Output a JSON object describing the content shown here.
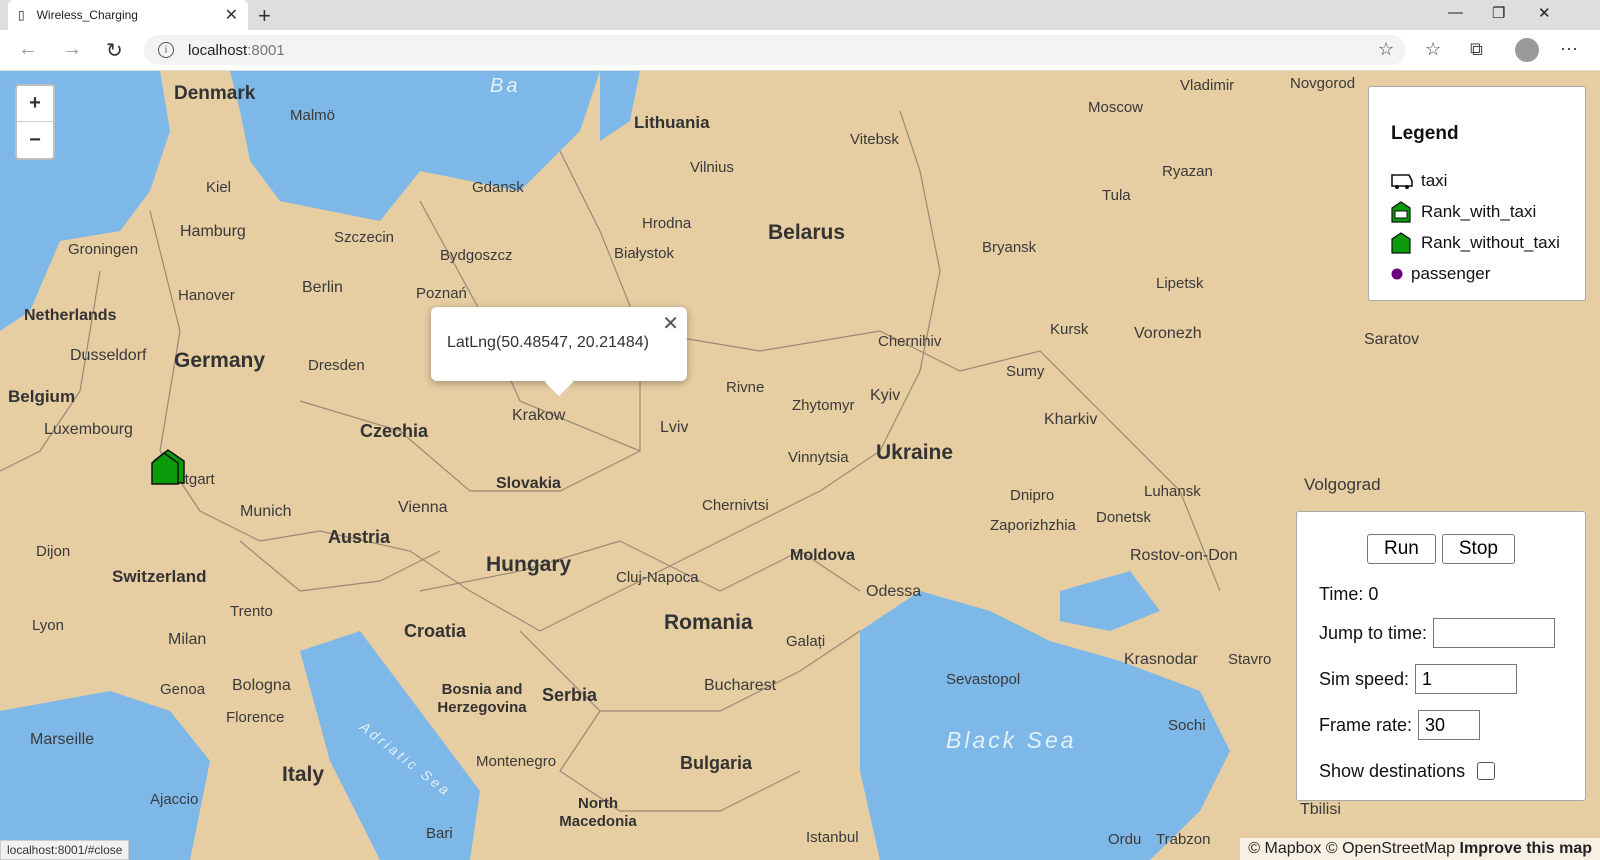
{
  "browser": {
    "tab_title": "Wireless_Charging",
    "address_host": "localhost",
    "address_port": ":8001",
    "status_url": "localhost:8001/#close"
  },
  "map": {
    "zoom_in": "+",
    "zoom_out": "−",
    "popup_text": "LatLng(50.48547, 20.21484)",
    "popup_close": "✕",
    "labels": {
      "denmark": "Denmark",
      "malmo": "Malmö",
      "lithuania": "Lithuania",
      "vilnius": "Vilnius",
      "moscow": "Moscow",
      "vladimir": "Vladimir",
      "novgorod": "Novgorod",
      "vitebsk": "Vitebsk",
      "kiel": "Kiel",
      "gdansk": "Gdansk",
      "hrodna": "Hrodna",
      "belarus": "Belarus",
      "ryazan": "Ryazan",
      "tula": "Tula",
      "groningen": "Groningen",
      "hamburg": "Hamburg",
      "szczecin": "Szczecin",
      "bydgoszcz": "Bydgoszcz",
      "bialystok": "Białystok",
      "bryansk": "Bryansk",
      "hanover": "Hanover",
      "berlin": "Berlin",
      "poznan": "Poznań",
      "lipetsk": "Lipetsk",
      "netherlands": "Netherlands",
      "dusseldorf": "Dusseldorf",
      "germany": "Germany",
      "dresden": "Dresden",
      "chernihiv": "Chernihiv",
      "kursk": "Kursk",
      "voronezh": "Voronezh",
      "saratov": "Saratov",
      "belgium": "Belgium",
      "krakow": "Krakow",
      "rivne": "Rivne",
      "zhytomyr": "Zhytomyr",
      "kyiv": "Kyiv",
      "sumy": "Sumy",
      "luxembourg": "Luxembourg",
      "czechia": "Czechia",
      "lviv": "Lviv",
      "kharkiv": "Kharkiv",
      "ukraine": "Ukraine",
      "vinnytsia": "Vinnytsia",
      "stuttgart": "Stuttgart",
      "slovakia": "Slovakia",
      "luhansk": "Luhansk",
      "volgograd": "Volgograd",
      "munich": "Munich",
      "vienna": "Vienna",
      "chernivtsi": "Chernivtsi",
      "dnipro": "Dnipro",
      "zaporizhzhia": "Zaporizhzhia",
      "donetsk": "Donetsk",
      "austria": "Austria",
      "dijon": "Dijon",
      "moldova": "Moldova",
      "rostov": "Rostov-on-Don",
      "hungary": "Hungary",
      "switzerland": "Switzerland",
      "clujnapoca": "Cluj-Napoca",
      "odessa": "Odessa",
      "trento": "Trento",
      "romania": "Romania",
      "lyon": "Lyon",
      "croatia": "Croatia",
      "milan": "Milan",
      "galati": "Galați",
      "krasnodar": "Krasnodar",
      "stavropol": "Stavro",
      "sevastopol": "Sevastopol",
      "bologna": "Bologna",
      "genoa": "Genoa",
      "bosnia": "Bosnia and Herzegovina",
      "serbia": "Serbia",
      "bucharest": "Bucharest",
      "florence": "Florence",
      "sochi": "Sochi",
      "marseille": "Marseille",
      "blacksea": "Black Sea",
      "montenegro": "Montenegro",
      "bulgaria": "Bulgaria",
      "italy": "Italy",
      "adriatic": "Adriatic Sea",
      "ajaccio": "Ajaccio",
      "northmacedonia": "North Macedonia",
      "tbilisi": "Tbilisi",
      "bari": "Bari",
      "istanbul": "Istanbul",
      "ordu": "Ordu",
      "trabzon": "Trabzon",
      "baltic": "Ba"
    }
  },
  "legend": {
    "title": "Legend",
    "items": [
      "taxi",
      "Rank_with_taxi",
      "Rank_without_taxi",
      "passenger"
    ],
    "colors": {
      "rank": "#0a9a0a",
      "passenger": "#6a007a"
    }
  },
  "controls": {
    "run": "Run",
    "stop": "Stop",
    "time_label": "Time: 0",
    "jump_label": "Jump to time:",
    "jump_value": "",
    "speed_label": "Sim speed:",
    "speed_value": "1",
    "framerate_label": "Frame rate:",
    "framerate_value": "30",
    "show_dest_label": "Show destinations"
  },
  "attribution": {
    "mapbox": "© Mapbox",
    "osm": "© OpenStreetMap",
    "improve": "Improve this map"
  }
}
